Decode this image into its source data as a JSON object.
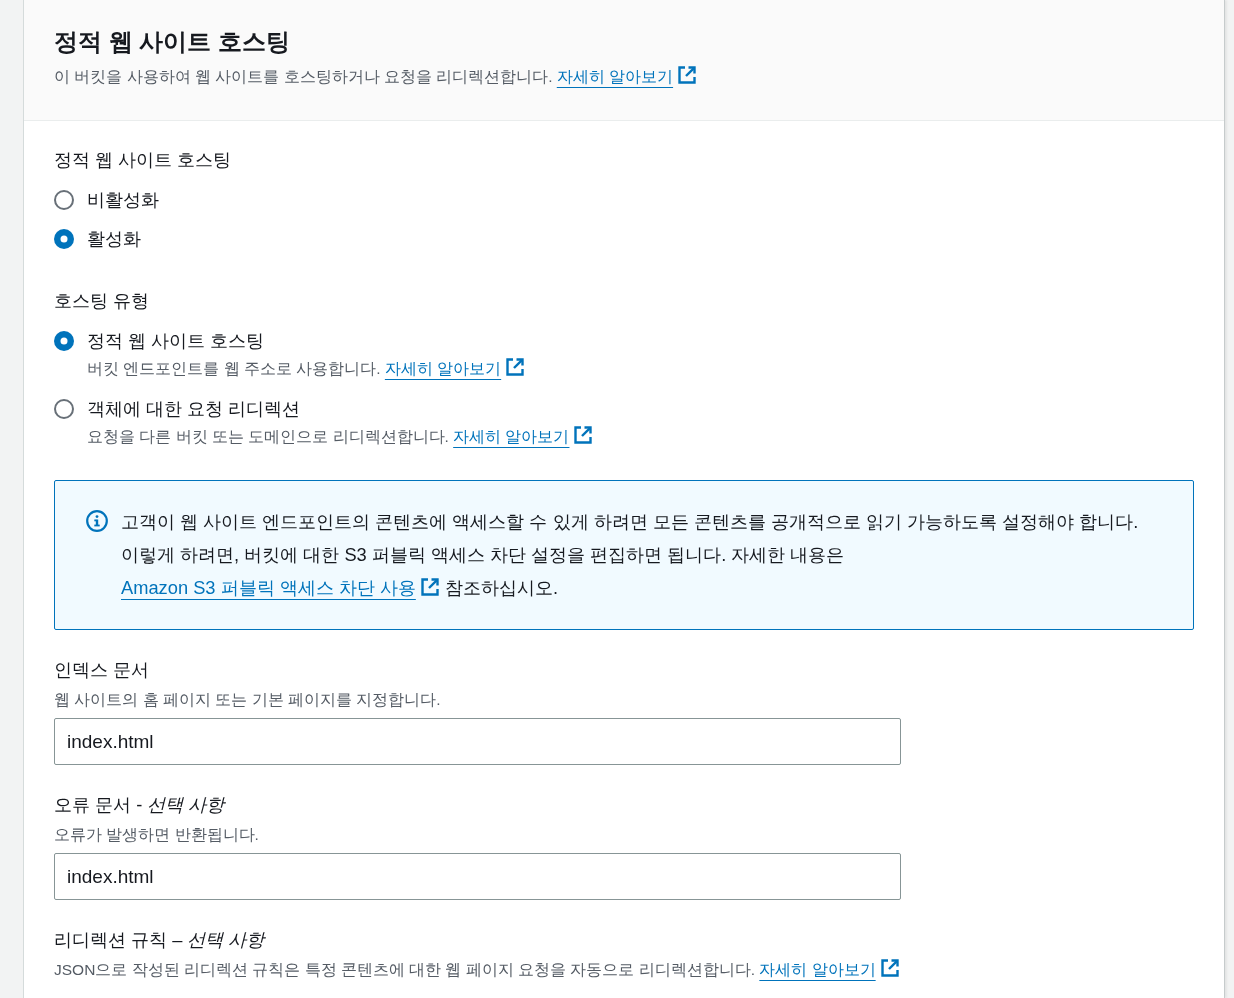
{
  "header": {
    "title": "정적 웹 사이트 호스팅",
    "description": "이 버킷을 사용하여 웹 사이트를 호스팅하거나 요청을 리디렉션합니다.",
    "link": "자세히 알아보기"
  },
  "static_hosting": {
    "label": "정적 웹 사이트 호스팅",
    "options": [
      {
        "label": "비활성화",
        "selected": false
      },
      {
        "label": "활성화",
        "selected": true
      }
    ]
  },
  "hosting_type": {
    "label": "호스팅 유형",
    "options": [
      {
        "label": "정적 웹 사이트 호스팅",
        "description": "버킷 엔드포인트를 웹 주소로 사용합니다.",
        "link": "자세히 알아보기",
        "selected": true
      },
      {
        "label": "객체에 대한 요청 리디렉션",
        "description": "요청을 다른 버킷 또는 도메인으로 리디렉션합니다.",
        "link": "자세히 알아보기",
        "selected": false
      }
    ]
  },
  "alert": {
    "kind": "info",
    "text": "고객이 웹 사이트 엔드포인트의 콘텐츠에 액세스할 수 있게 하려면 모든 콘텐츠를 공개적으로 읽기 가능하도록 설정해야 합니다. 이렇게 하려면, 버킷에 대한 S3 퍼블릭 액세스 차단 설정을 편집하면 됩니다. 자세한 내용은",
    "link": "Amazon S3 퍼블릭 액세스 차단 사용",
    "text_after": "참조하십시오."
  },
  "fields": [
    {
      "label": "인덱스 문서",
      "description": "웹 사이트의 홈 페이지 또는 기본 페이지를 지정합니다.",
      "value": "index.html"
    },
    {
      "label": "오류 문서 - *선택 사항*",
      "description": "오류가 발생하면 반환됩니다.",
      "value": "index.html"
    },
    {
      "label": "리디렉션 규칙 – *선택 사항*",
      "description": "JSON으로 작성된 리디렉션 규칙은 특정 콘텐츠에 대한 웹 페이지 요청을 자동으로 리디렉션합니다.",
      "link": "자세히 알아보기"
    }
  ]
}
